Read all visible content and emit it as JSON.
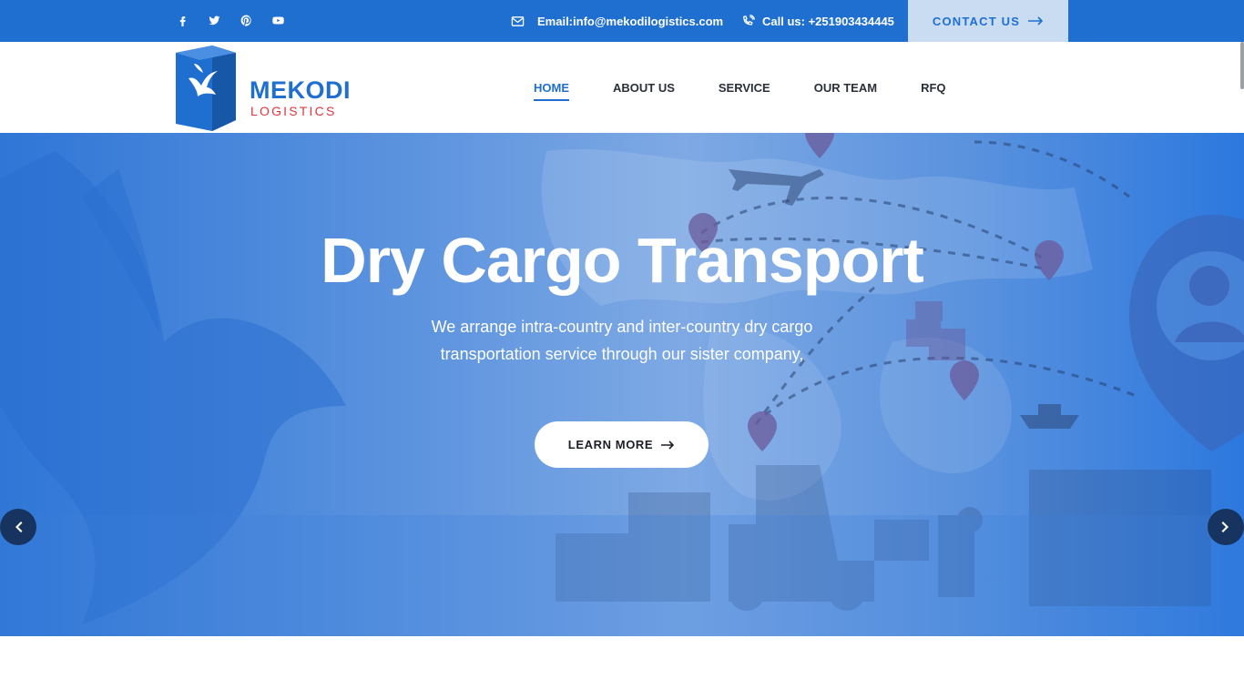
{
  "topbar": {
    "social_icons": [
      "facebook-icon",
      "twitter-icon",
      "pinterest-icon",
      "youtube-icon"
    ],
    "email": "Email:info@mekodilogistics.com",
    "phone": "Call us: +251903434445",
    "contact_button": "CONTACT US"
  },
  "header": {
    "logo_word": "MEKODI",
    "logo_sub": "LOGISTICS",
    "nav": [
      {
        "label": "HOME",
        "active": true
      },
      {
        "label": "ABOUT US",
        "active": false
      },
      {
        "label": "SERVICE",
        "active": false
      },
      {
        "label": "OUR TEAM",
        "active": false
      },
      {
        "label": "RFQ",
        "active": false
      }
    ]
  },
  "hero": {
    "title": "Dry Cargo Transport",
    "subtitle": "We arrange intra-country and inter-country dry cargo transportation service through our sister company,",
    "button": "LEARN MORE"
  },
  "colors": {
    "primary": "#1f6fd1",
    "accent_red": "#e0373d",
    "contact_bg": "#c9dcf2",
    "arrow_bg": "#17335f"
  }
}
